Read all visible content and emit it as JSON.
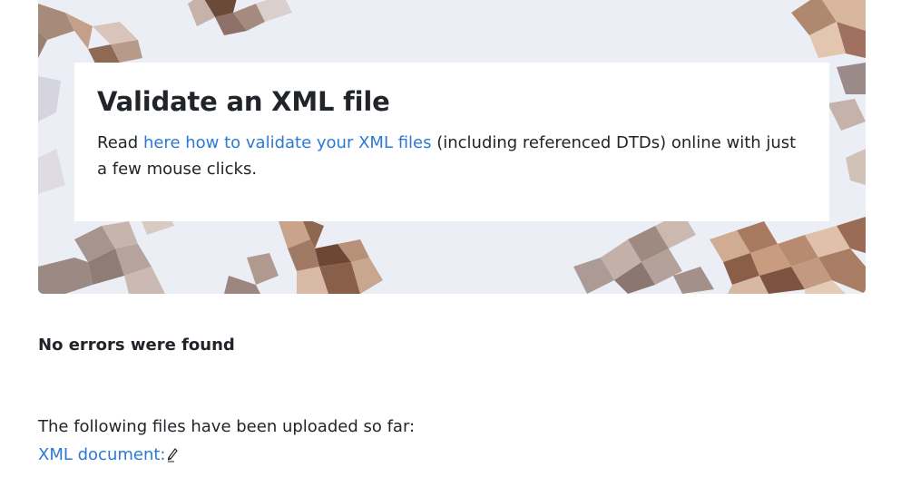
{
  "hero": {
    "title": "Validate an XML file",
    "text_before": "Read ",
    "link_label": "here how to validate your XML files",
    "text_after": " (including referenced DTDs) online with just a few mouse clicks."
  },
  "result": {
    "status": "No errors were found"
  },
  "uploads": {
    "intro": "The following files have been uploaded so far:",
    "file_label": "XML document:",
    "edit_icon": "pencil-icon"
  },
  "colors": {
    "link": "#2a7ad5",
    "text": "#212529",
    "hero_bg": "#eceef6"
  }
}
